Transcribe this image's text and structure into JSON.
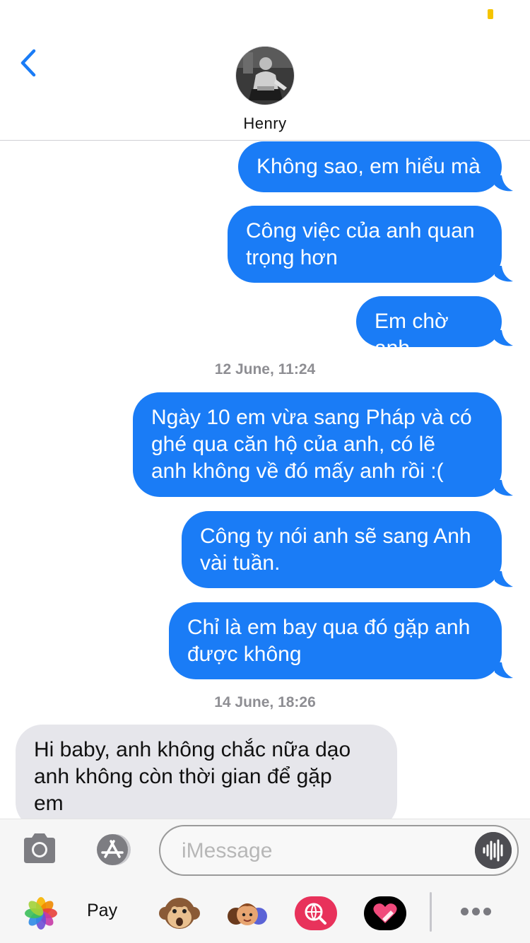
{
  "contact": {
    "name": "Henry"
  },
  "messages": [
    {
      "direction": "out",
      "text": "Không sao, em hiểu mà"
    },
    {
      "direction": "out",
      "text": "Công việc của anh quan\ntrọng hơn"
    },
    {
      "direction": "out",
      "text": "Em chờ anh"
    },
    {
      "timestamp": "12 June, 11:24"
    },
    {
      "direction": "out",
      "text": "Ngày 10 em vừa sang Pháp và có\nghé qua căn hộ của anh, có lẽ\nanh không về đó mấy anh rồi :("
    },
    {
      "direction": "out",
      "text": "Công ty nói anh sẽ sang Anh\nvài tuần."
    },
    {
      "direction": "out",
      "text": "Chỉ là em bay qua đó gặp anh\nđược không"
    },
    {
      "timestamp": "14 June, 18:26"
    },
    {
      "direction": "in",
      "text": "Hi baby, anh không chắc nữa dạo\nanh không còn thời gian để gặp\nem"
    }
  ],
  "input": {
    "placeholder": "iMessage"
  },
  "drawer": {
    "applepay_label": "Pay"
  },
  "colors": {
    "outgoing_bubble": "#1a7cf6",
    "incoming_bubble": "#e6e6eb",
    "accent": "#1a7cf6",
    "timestamp": "#8e8e93"
  }
}
